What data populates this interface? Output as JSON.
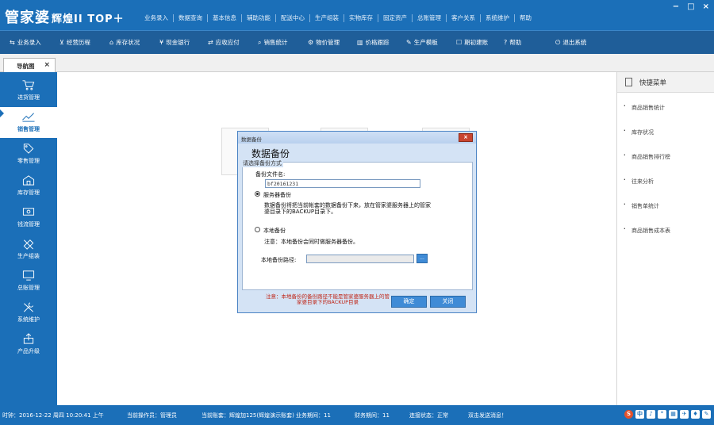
{
  "app": {
    "logo": "管家婆",
    "logo_sub": "辉煌II TOP＋",
    "top_menu": [
      "业务录入",
      "数据查询",
      "基本信息",
      "辅助功能",
      "配送中心",
      "生产组装",
      "实物库存",
      "固定资产",
      "总账管理",
      "客户关系",
      "系统维护",
      "帮助"
    ],
    "window_controls": [
      "−",
      "□",
      "×"
    ]
  },
  "toolbar": [
    {
      "icon": "switch-icon",
      "glyph": "⇆",
      "label": "业务录入"
    },
    {
      "icon": "chart-icon",
      "glyph": "⊻",
      "label": "经营历程"
    },
    {
      "icon": "home-icon",
      "glyph": "⌂",
      "label": "库存状况"
    },
    {
      "icon": "yen-icon",
      "glyph": "¥",
      "label": "现金银行"
    },
    {
      "icon": "transfer-icon",
      "glyph": "⇄",
      "label": "应收应付"
    },
    {
      "icon": "search-icon",
      "glyph": "⌕",
      "label": "销售统计"
    },
    {
      "icon": "gear-icon",
      "glyph": "⚙",
      "label": "物价管理"
    },
    {
      "icon": "bar-chart-icon",
      "glyph": "▥",
      "label": "价格跟踪"
    },
    {
      "icon": "wrench-icon",
      "glyph": "✎",
      "label": "生产模板"
    },
    {
      "icon": "calendar-icon",
      "glyph": "☐",
      "label": "期初建账"
    },
    {
      "icon": "help-icon",
      "glyph": "?",
      "label": "帮助"
    },
    {
      "icon": "power-icon",
      "glyph": "⏻",
      "label": "退出系统"
    }
  ],
  "tab": {
    "label": "导航图",
    "close": "×"
  },
  "sidebar": [
    {
      "label": "进货管理",
      "icon": "cart-icon"
    },
    {
      "label": "销售管理",
      "icon": "trend-icon"
    },
    {
      "label": "零售管理",
      "icon": "tag-icon"
    },
    {
      "label": "库存管理",
      "icon": "warehouse-icon"
    },
    {
      "label": "钱流管理",
      "icon": "money-icon"
    },
    {
      "label": "生产组装",
      "icon": "tools-icon"
    },
    {
      "label": "总账管理",
      "icon": "monitor-icon"
    },
    {
      "label": "系统维护",
      "icon": "wrench-icon"
    },
    {
      "label": "产品升级",
      "icon": "upload-icon"
    }
  ],
  "quick_menu": {
    "title": "快捷菜单",
    "items": [
      "商品销售统计",
      "库存状况",
      "商品销售排行榜",
      "往来分析",
      "销售单统计",
      "商品销售成本表"
    ]
  },
  "dialog": {
    "title": "数据备份",
    "heading": "数据备份",
    "group_label": "请选择备份方式",
    "filename_label": "备份文件名:",
    "filename_value": "bf20161231",
    "server_option": "服务器备份",
    "server_desc": "数据备份将把当前帐套的数据备份下来，放在管家婆服务器上的管家婆目录下的BACKUP目录下。",
    "local_option": "本地备份",
    "local_note": "注意：本地备份会同时做服务器备份。",
    "local_path_label": "本地备份路径:",
    "local_path_value": "",
    "browse_label": "...",
    "warning": "注意：本地备份的备份路径不能是管家婆服务器上的管家婆目录下的BACKUP目录",
    "ok_label": "确定",
    "close_label": "关闭",
    "close_x": "×",
    "server_selected": true
  },
  "status": {
    "clock": "时钟：2016-12-22 周四 10:20:41 上午",
    "operator": "当前操作员：管理员",
    "account": "当前账套：辉煌加125(辉煌演示账套) 业务期间：11",
    "finance_period": "财务期间：11",
    "connection": "连接状态：正常",
    "message": "双击发送消息！"
  },
  "tray": [
    "S",
    "中",
    "♪",
    "°",
    "▦",
    "✈",
    "♦",
    "✎"
  ],
  "colors": {
    "primary": "#1b6fb8",
    "toolbar": "#1f5e99",
    "warning": "#c0281a",
    "button": "#3f8bd6"
  }
}
